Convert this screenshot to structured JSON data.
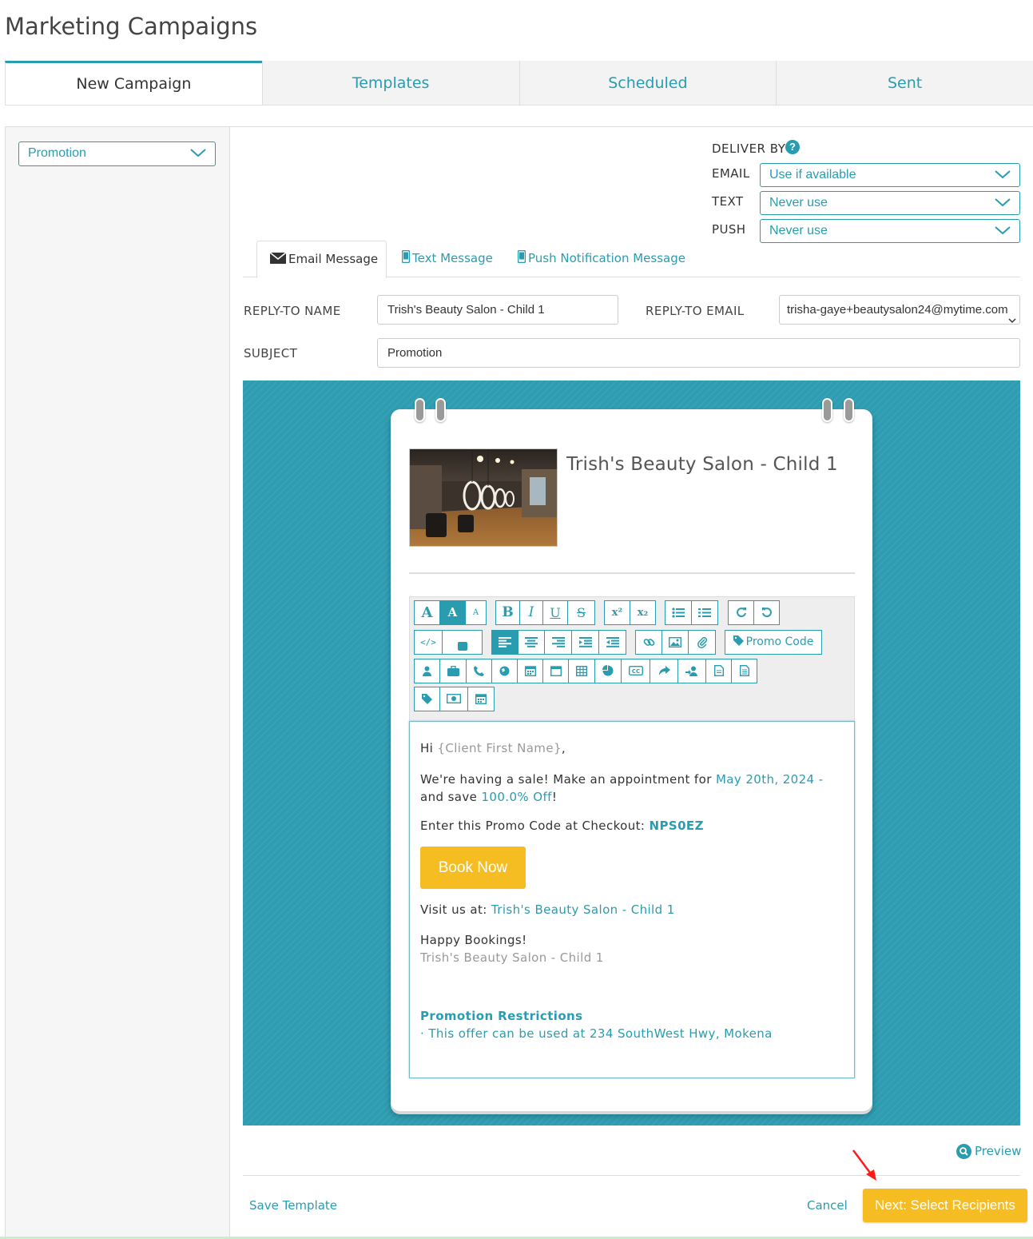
{
  "page": {
    "title": "Marketing Campaigns"
  },
  "tabs": [
    {
      "label": "New Campaign",
      "active": true
    },
    {
      "label": "Templates"
    },
    {
      "label": "Scheduled"
    },
    {
      "label": "Sent"
    }
  ],
  "sidebar": {
    "campaign_type": "Promotion"
  },
  "deliver_by": {
    "label": "DELIVER BY",
    "help_icon": "?",
    "email": {
      "label": "EMAIL",
      "value": "Use if available"
    },
    "text": {
      "label": "TEXT",
      "value": "Never use"
    },
    "push": {
      "label": "PUSH",
      "value": "Never use"
    }
  },
  "message_tabs": [
    {
      "label": "Email Message",
      "icon": "envelope-icon",
      "active": true
    },
    {
      "label": "Text Message",
      "icon": "mobile-phone-icon"
    },
    {
      "label": "Push Notification Message",
      "icon": "mobile-phone-icon"
    }
  ],
  "form": {
    "reply_to_name_label": "REPLY-TO NAME",
    "reply_to_name": "Trish's Beauty Salon - Child 1",
    "reply_to_email_label": "REPLY-TO EMAIL",
    "reply_to_email": "trisha-gaye+beautysalon24@mytime.com",
    "subject_label": "SUBJECT",
    "subject": "Promotion"
  },
  "email_preview": {
    "salon_name": "Trish's Beauty Salon - Child 1",
    "toolbar": {
      "promo_code_label": "Promo Code",
      "font_sizes": [
        "A",
        "A",
        "A"
      ],
      "format": [
        "B",
        "I",
        "U",
        "S"
      ],
      "scripts": [
        "x²",
        "x₂"
      ]
    },
    "body": {
      "greeting_prefix": "Hi ",
      "greeting_token": "{Client First Name}",
      "greeting_suffix": ",",
      "sale_prefix": "We're having a sale! Make an appointment for ",
      "sale_date": "May 20th, 2024 -",
      "sale_mid": "and save ",
      "sale_discount": "100.0% Off",
      "sale_suffix": "!",
      "promo_prefix": "Enter this Promo Code at Checkout: ",
      "promo_code": "NPS0EZ",
      "book_button": "Book Now",
      "visit_prefix": "Visit us at: ",
      "visit_link": "Trish's Beauty Salon - Child 1",
      "signoff": "Happy Bookings!",
      "signature": "Trish's Beauty Salon - Child 1",
      "restrictions_title": "Promotion Restrictions",
      "restriction_1": "· This offer can be used at 234 SouthWest Hwy, Mokena"
    }
  },
  "footer": {
    "preview_label": "Preview",
    "save_template": "Save Template",
    "cancel": "Cancel",
    "next": "Next: Select Recipients"
  },
  "colors": {
    "accent": "#2a9cb0",
    "button": "#f5bd22",
    "panel": "#2e9cb1"
  }
}
